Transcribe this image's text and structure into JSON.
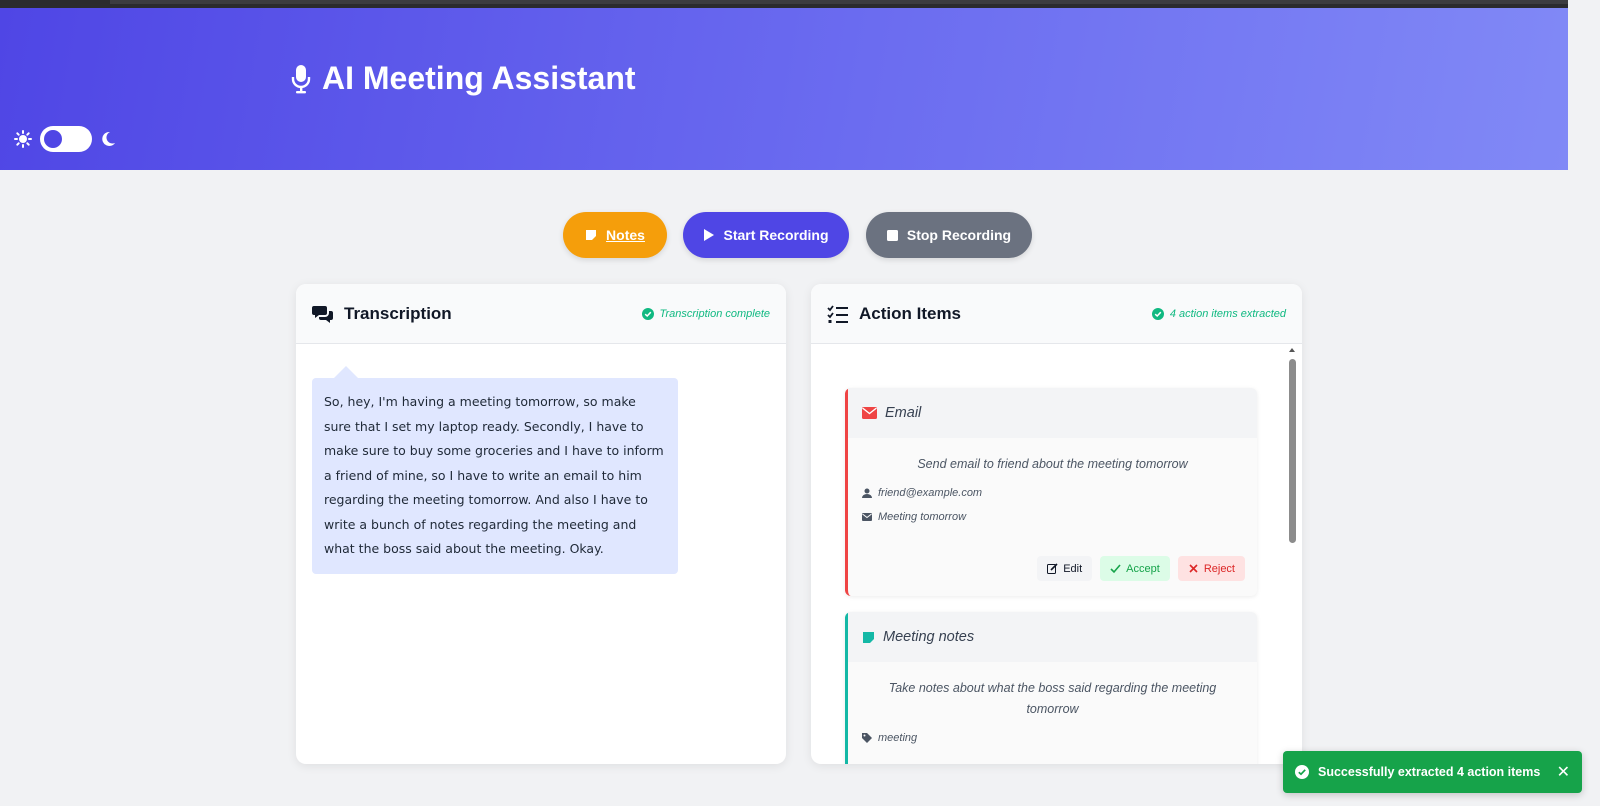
{
  "header": {
    "title": "AI Meeting Assistant",
    "icon": "microphone-icon",
    "theme_toggle": {
      "light_icon": "sun-icon",
      "dark_icon": "moon-icon"
    }
  },
  "controls": {
    "notes_label": "Notes",
    "start_label": "Start Recording",
    "stop_label": "Stop Recording"
  },
  "transcription": {
    "title": "Transcription",
    "status": "Transcription complete",
    "text": "So, hey, I'm having a meeting tomorrow, so make sure that I set my laptop ready. Secondly, I have to make sure to buy some groceries and I have to inform a friend of mine, so I have to write an email to him regarding the meeting tomorrow. And also I have to write a bunch of notes regarding the meeting and what the boss said about the meeting. Okay."
  },
  "action_items": {
    "title": "Action Items",
    "status": "4 action items extracted",
    "items": [
      {
        "type": "Email",
        "description": "Send email to friend about the meeting tomorrow",
        "recipient": "friend@example.com",
        "subject": "Meeting tomorrow",
        "accent": "#ef4444",
        "buttons": {
          "edit": "Edit",
          "accept": "Accept",
          "reject": "Reject"
        }
      },
      {
        "type": "Meeting notes",
        "description": "Take notes about what the boss said regarding the meeting tomorrow",
        "tag": "meeting",
        "accent": "#14b8a6"
      }
    ]
  },
  "toast": {
    "message": "Successfully extracted 4 action items"
  },
  "colors": {
    "primary": "#4f46e5",
    "notes": "#f59e0b",
    "stop": "#6b7280",
    "success": "#10b981"
  }
}
